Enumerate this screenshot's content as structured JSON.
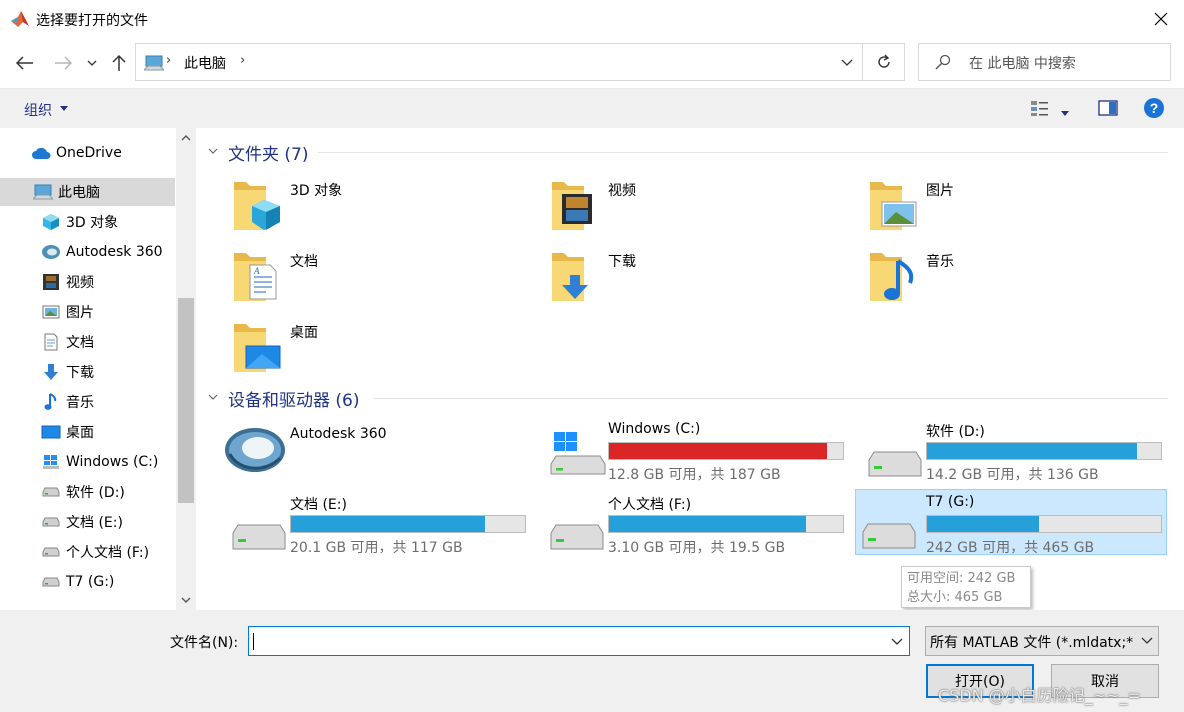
{
  "window": {
    "title": "选择要打开的文件",
    "app_icon": "matlab-icon",
    "close_icon": "close-icon"
  },
  "nav": {
    "back_icon": "arrow-left-icon",
    "forward_icon": "arrow-right-icon",
    "recent_icon": "chevron-down-icon",
    "up_icon": "arrow-up-icon",
    "breadcrumb": "此电脑",
    "refresh_icon": "refresh-icon",
    "search_placeholder": "在 此电脑 中搜索"
  },
  "toolbar": {
    "organize_label": "组织",
    "view_icon": "view-options-icon",
    "preview_pane_icon": "preview-pane-icon",
    "help_icon": "help-icon",
    "help_glyph": "?"
  },
  "sidebar": {
    "items": [
      {
        "label": "OneDrive",
        "icon": "cloud-icon"
      },
      {
        "label": "此电脑",
        "icon": "computer-icon",
        "selected": true
      },
      {
        "label": "3D 对象",
        "icon": "cube-icon"
      },
      {
        "label": "Autodesk 360",
        "icon": "autodesk-icon"
      },
      {
        "label": "视频",
        "icon": "film-icon"
      },
      {
        "label": "图片",
        "icon": "picture-icon"
      },
      {
        "label": "文档",
        "icon": "document-icon"
      },
      {
        "label": "下载",
        "icon": "download-icon"
      },
      {
        "label": "音乐",
        "icon": "music-icon"
      },
      {
        "label": "桌面",
        "icon": "desktop-icon"
      },
      {
        "label": "Windows (C:)",
        "icon": "windows-drive-icon"
      },
      {
        "label": "软件 (D:)",
        "icon": "drive-icon"
      },
      {
        "label": "文档 (E:)",
        "icon": "drive-icon"
      },
      {
        "label": "个人文档 (F:)",
        "icon": "drive-icon"
      },
      {
        "label": "T7 (G:)",
        "icon": "drive-icon"
      }
    ]
  },
  "folders_group": {
    "label": "文件夹 (7)",
    "items": [
      {
        "name": "3D 对象",
        "overlay": "cube"
      },
      {
        "name": "视频",
        "overlay": "film"
      },
      {
        "name": "图片",
        "overlay": "picture"
      },
      {
        "name": "文档",
        "overlay": "document"
      },
      {
        "name": "下载",
        "overlay": "download"
      },
      {
        "name": "音乐",
        "overlay": "music"
      },
      {
        "name": "桌面",
        "overlay": "desktop"
      }
    ]
  },
  "devices_group": {
    "label": "设备和驱动器 (6)",
    "autodesk": {
      "name": "Autodesk 360"
    },
    "drives": [
      {
        "name": "Windows (C:)",
        "info": "12.8 GB 可用，共 187 GB",
        "used_fraction": 0.932,
        "low_space": true,
        "icon": "windows-drive-icon"
      },
      {
        "name": "软件 (D:)",
        "info": "14.2 GB 可用，共 136 GB",
        "used_fraction": 0.896,
        "icon": "drive-icon"
      },
      {
        "name": "文档 (E:)",
        "info": "20.1 GB 可用，共 117 GB",
        "used_fraction": 0.828,
        "icon": "drive-icon"
      },
      {
        "name": "个人文档 (F:)",
        "info": "3.10 GB 可用，共 19.5 GB",
        "used_fraction": 0.841,
        "icon": "drive-icon"
      },
      {
        "name": "T7 (G:)",
        "info": "242 GB 可用，共 465 GB",
        "used_fraction": 0.48,
        "icon": "drive-icon",
        "hovered": true
      }
    ]
  },
  "tooltip": {
    "line1": "可用空间: 242 GB",
    "line2": "总大小: 465 GB"
  },
  "bottom": {
    "filename_label": "文件名(N):",
    "filename_value": "",
    "filter_value": "所有 MATLAB 文件 (*.mldatx;*",
    "open_label": "打开(O)",
    "cancel_label": "取消"
  },
  "watermark": "CSDN @小白历险记_~~_=",
  "colors": {
    "accent": "#0078d7",
    "group_header": "#1e3287",
    "bar_fill": "#26a0da",
    "bar_full": "#da2626",
    "hover_bg": "#cce8ff",
    "selected_bg": "#d9d9d9"
  }
}
